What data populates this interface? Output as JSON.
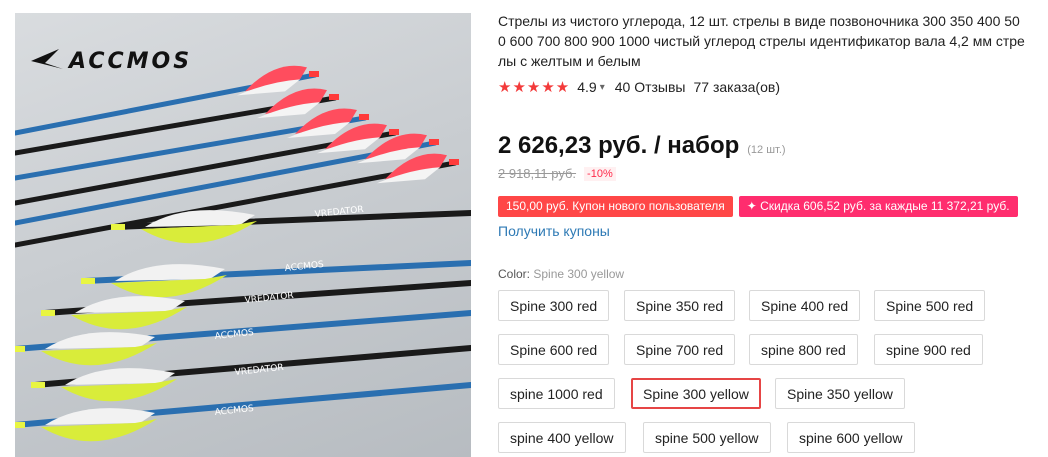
{
  "product": {
    "title": "Стрелы из чистого углерода, 12 шт. стрелы в виде позвоночника 300 350 400 500 600 700 800 900 1000 чистый углерод стрелы идентификатор вала 4,2 мм стрелы с желтым и белым",
    "title_lines": [
      "Стрелы из чистого углерода, 12 шт. стрелы в виде позвоночника 300 350 400 50",
      "0 600 700 800 900 1000 чистый углерод стрелы идентификатор вала 4,2 мм стре",
      "лы с желтым и белым"
    ],
    "brand_logo_text": "ACCMOS",
    "shaft_print_texts": [
      "VREDATOR",
      "ACCMOS"
    ]
  },
  "rating": {
    "stars": "★★★★★",
    "value": "4.9",
    "reviews": "40 Отзывы",
    "orders": "77 заказа(ов)"
  },
  "price": {
    "current": "2 626,23 руб. / набор",
    "unit_count": "(12 шт.)",
    "old": "2 918,11 руб.",
    "discount": "-10%"
  },
  "coupons": [
    "150,00 руб. Купон нового пользователя",
    "✦ Скидка 606,52 руб. за каждые 11 372,21 руб."
  ],
  "get_coupons_label": "Получить купоны",
  "color": {
    "label": "Color:",
    "selected": "Spine 300 yellow"
  },
  "options": [
    "Spine 300 red",
    "Spine 350 red",
    "Spine 400 red",
    "Spine 500 red",
    "Spine 600 red",
    "Spine 700 red",
    "spine 800 red",
    "spine 900 red",
    "spine 1000 red",
    "Spine 300 yellow",
    "Spine 350 yellow",
    "spine 400 yellow",
    "spine 500 yellow",
    "spine 600 yellow"
  ],
  "colors": {
    "price_red": "#ff4747",
    "discount_pink": "#ff2d6e",
    "link_blue": "#2e7ab5",
    "selected_border": "#e64545",
    "fletch_red": "#ff4d5e",
    "fletch_yellow": "#d9ec3a",
    "shaft_blue": "#2a6fb0"
  }
}
